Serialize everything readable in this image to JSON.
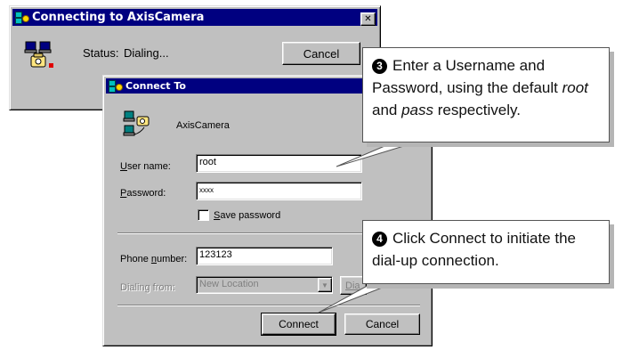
{
  "connecting_window": {
    "title": "Connecting to AxisCamera",
    "close_glyph": "✕",
    "status_label": "Status:",
    "status_value": "Dialing...",
    "cancel_label": "Cancel"
  },
  "connect_dialog": {
    "title": "Connect To",
    "connection_name": "AxisCamera",
    "user_name_label_underlined": "U",
    "user_name_label_rest": "ser name:",
    "user_name_value": "root",
    "password_label_underlined": "P",
    "password_label_rest": "assword:",
    "password_value": "xxxx",
    "save_password_underlined": "S",
    "save_password_rest": "ave password",
    "save_password_checked": false,
    "phone_label_prefix": "Phone ",
    "phone_label_underlined": "n",
    "phone_label_rest": "umber:",
    "phone_value": "123123",
    "dialing_from_label": "Dialing from:",
    "dialing_from_value": "New Location",
    "dial_properties_label": "Dia",
    "connect_label": "Connect",
    "cancel_label": "Cancel"
  },
  "callouts": [
    {
      "number": "3",
      "text_before": "Enter a Username and Password, using the default ",
      "emph1": "root",
      "text_mid": " and ",
      "emph2": "pass",
      "text_after": " respectively."
    },
    {
      "number": "4",
      "text": "Click Connect to initiate the dial-up connection."
    }
  ]
}
